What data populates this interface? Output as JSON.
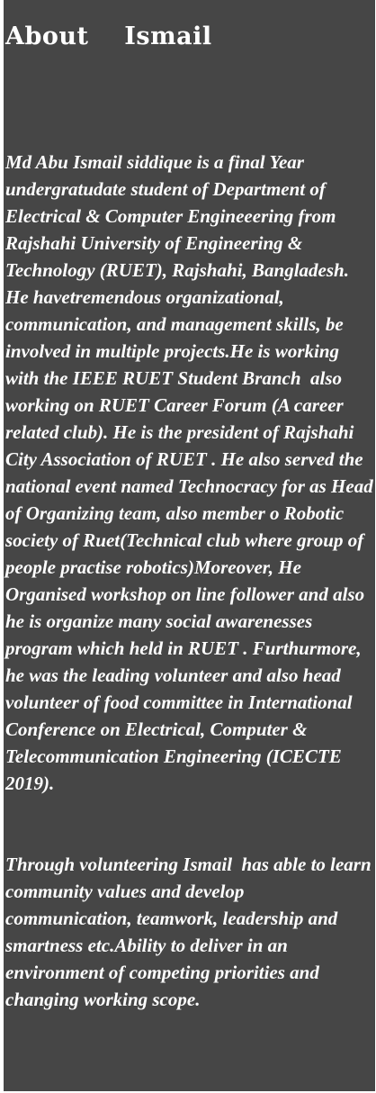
{
  "section": {
    "title": "About  Ismail",
    "paragraphs": [
      "Md Abu Ismail siddique is a final Year undergratudate student of Department of Electrical & Computer Engineeering from Rajshahi University of Engineering & Technology (RUET), Rajshahi, Bangladesh. He havetremendous organizational, communication, and management skills, be involved in multiple projects.He is working with the IEEE RUET Student Branch  also working on RUET Career Forum (A career related club). He is the president of Rajshahi City Association of RUET . He also served the national event named Technocracy for as Head of Organizing team, also member o Robotic society of Ruet(Technical club where group of people practise robotics)Moreover, He Organised workshop on line follower and also he is organize many social awarenesses program which held in RUET . Furthurmore, he was the leading volunteer and also head volunteer of food committee in International Conference on Electrical, Computer & Telecommunication Engineering (ICECTE 2019).",
      "Through volunteering Ismail  has able to learn community values and develop communication, teamwork, leadership and smartness etc.Ability to deliver in an environment of competing priorities and changing working scope."
    ]
  },
  "colors": {
    "panel_background": "#464646",
    "text": "#ffffff"
  }
}
